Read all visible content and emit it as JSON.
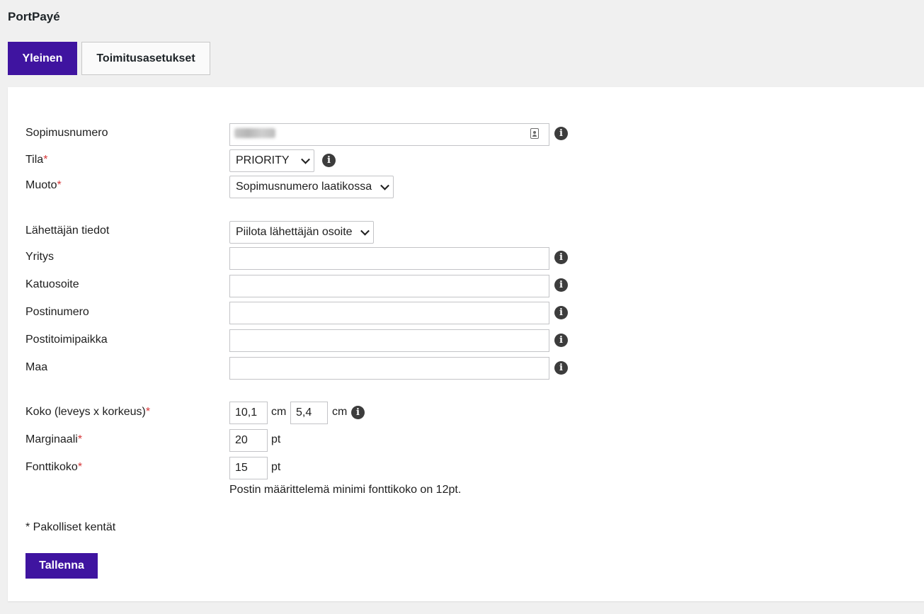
{
  "app": {
    "title": "PortPayé"
  },
  "tabs": [
    {
      "label": "Yleinen",
      "active": true
    },
    {
      "label": "Toimitusasetukset",
      "active": false
    }
  ],
  "form": {
    "contract_number": {
      "label": "Sopimusnumero",
      "value": ""
    },
    "mode": {
      "label": "Tila",
      "required_mark": "*",
      "selected": "PRIORITY"
    },
    "format": {
      "label": "Muoto",
      "required_mark": "*",
      "selected": "Sopimusnumero laatikossa"
    },
    "sender_info": {
      "label": "Lähettäjän tiedot",
      "selected": "Piilota lähettäjän osoite"
    },
    "company": {
      "label": "Yritys",
      "value": ""
    },
    "street": {
      "label": "Katuosoite",
      "value": ""
    },
    "postal_code": {
      "label": "Postinumero",
      "value": ""
    },
    "city": {
      "label": "Postitoimipaikka",
      "value": ""
    },
    "country": {
      "label": "Maa",
      "value": ""
    },
    "size": {
      "label": "Koko (leveys x korkeus)",
      "required_mark": "*",
      "width": "10,1",
      "height": "5,4",
      "unit": "cm"
    },
    "margin": {
      "label": "Marginaali",
      "required_mark": "*",
      "value": "20",
      "unit": "pt"
    },
    "font_size": {
      "label": "Fonttikoko",
      "required_mark": "*",
      "value": "15",
      "unit": "pt",
      "hint": "Postin määrittelemä minimi fonttikoko on 12pt."
    },
    "required_note": "* Pakolliset kentät",
    "save_label": "Tallenna"
  },
  "icons": {
    "info": "info-icon",
    "contact": "contact-card-icon",
    "chevron": "chevron-down-icon"
  },
  "colors": {
    "accent": "#3f14a0",
    "background": "#f0f0f0",
    "panel": "#ffffff",
    "required": "#d63638"
  }
}
